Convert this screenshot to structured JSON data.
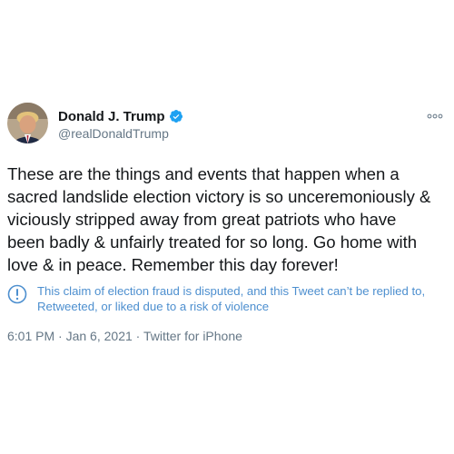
{
  "tweet": {
    "author": {
      "display_name": "Donald J. Trump",
      "handle": "@realDonaldTrump",
      "verified": true,
      "avatar": "profile-photo"
    },
    "more_menu_icon": "more-dots-icon",
    "text": "These are the things and events that happen when a\nsacred landslide election victory is so unceremoniously &\nviciously stripped away from great patriots who have\nbeen badly & unfairly treated for so long. Go home with\nlove & in peace. Remember this day forever!",
    "notice": {
      "icon": "exclamation-circle-icon",
      "text": "This claim of election fraud is disputed, and this Tweet can’t be replied to,\nRetweeted, or liked due to a risk of violence"
    },
    "time": "6:01 PM",
    "separator": "·",
    "date": "Jan 6, 2021",
    "source": "Twitter for iPhone"
  },
  "colors": {
    "text": "#14171a",
    "secondary": "#657786",
    "accent_blue": "#1da1f2",
    "notice_blue": "#4d8fcf"
  }
}
